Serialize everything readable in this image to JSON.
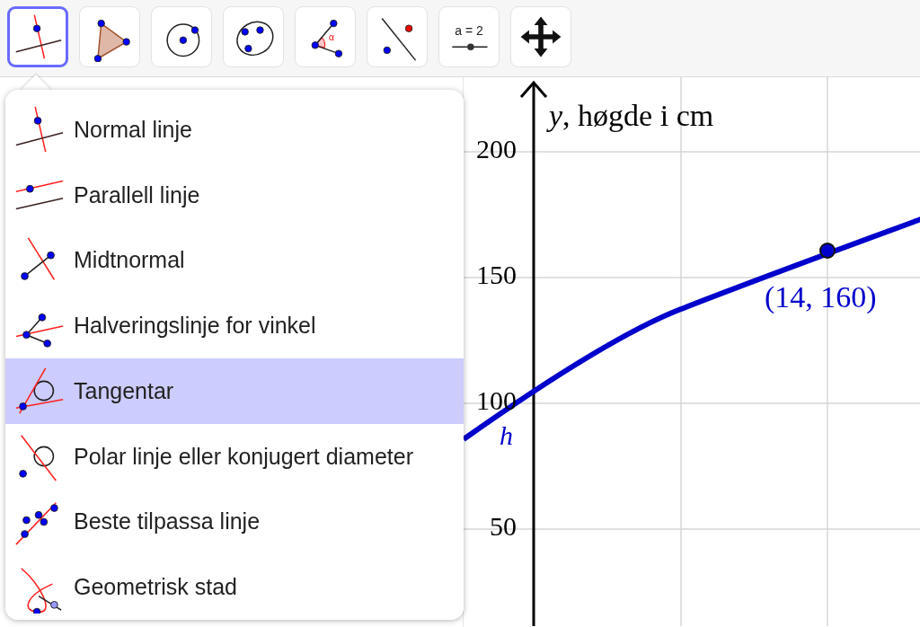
{
  "toolbar": [
    {
      "kind": "perpendicular",
      "selected": true
    },
    {
      "kind": "polygon",
      "selected": false
    },
    {
      "kind": "circle",
      "selected": false
    },
    {
      "kind": "conic",
      "selected": false
    },
    {
      "kind": "angle",
      "selected": false,
      "symbol": "α"
    },
    {
      "kind": "reflect",
      "selected": false
    },
    {
      "kind": "slider",
      "selected": false,
      "symbol": "a = 2"
    },
    {
      "kind": "move",
      "selected": false
    }
  ],
  "tool_menu": [
    {
      "kind": "perpendicular",
      "label": "Normal linje",
      "selected": false
    },
    {
      "kind": "parallel",
      "label": "Parallell linje",
      "selected": false
    },
    {
      "kind": "bisector",
      "label": "Midtnormal",
      "selected": false
    },
    {
      "kind": "anglebisector",
      "label": "Halveringslinje for vinkel",
      "selected": false
    },
    {
      "kind": "tangent",
      "label": "Tangentar",
      "selected": true
    },
    {
      "kind": "polar",
      "label": "Polar linje eller konjugert diameter",
      "selected": false
    },
    {
      "kind": "fit",
      "label": "Beste tilpassa linje",
      "selected": false
    },
    {
      "kind": "locus",
      "label": "Geometrisk stad",
      "selected": false
    }
  ],
  "graphics": {
    "y_axis_label": "*y*, høgde i cm",
    "y_ticks": [
      "200",
      "150",
      "100",
      "50"
    ],
    "function_label": "h",
    "point_label": "(14, 160)"
  }
}
